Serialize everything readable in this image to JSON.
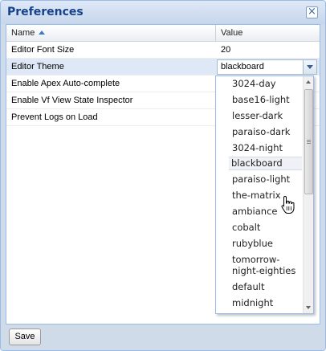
{
  "window": {
    "title": "Preferences",
    "close_label": "×"
  },
  "grid": {
    "headers": {
      "name": "Name",
      "value": "Value"
    },
    "rows": [
      {
        "name": "Editor Font Size",
        "value": "20"
      },
      {
        "name": "Editor Theme",
        "value": "blackboard"
      },
      {
        "name": "Enable Apex Auto-complete",
        "value": ""
      },
      {
        "name": "Enable Vf View State Inspector",
        "value": ""
      },
      {
        "name": "Prevent Logs on Load",
        "value": ""
      }
    ]
  },
  "dropdown": {
    "selected": "blackboard",
    "options": [
      "3024-day",
      "base16-light",
      "lesser-dark",
      "paraiso-dark",
      "3024-night",
      "blackboard",
      "paraiso-light",
      "the-matrix",
      "ambiance",
      "cobalt",
      "rubyblue",
      "tomorrow-",
      "night-eighties",
      "default",
      "midnight"
    ]
  },
  "footer": {
    "save_label": "Save"
  },
  "colors": {
    "title": "#15428b",
    "selected_row": "#dfe8f6",
    "border": "#99bbe8"
  },
  "icons": {
    "close": "close-icon",
    "sort": "sort-ascending-icon",
    "combo": "chevron-down-icon",
    "cursor": "hand-pointer-icon"
  }
}
